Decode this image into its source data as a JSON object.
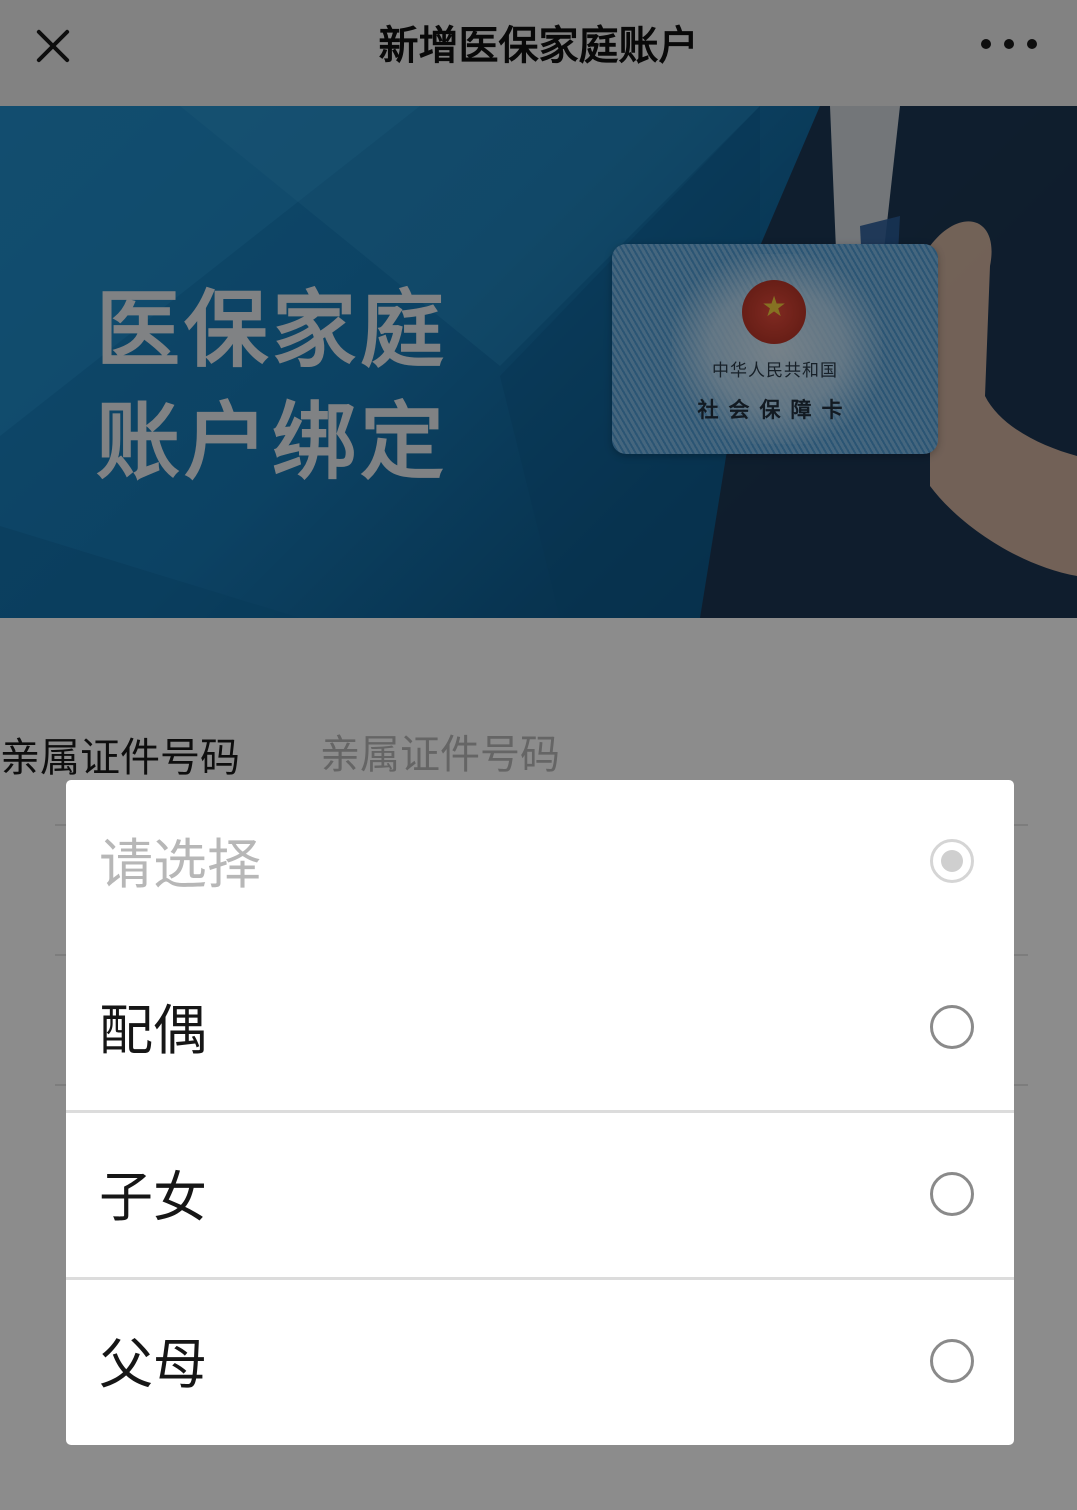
{
  "header": {
    "title": "新增医保家庭账户",
    "close_icon": "close-icon",
    "more_icon": "more-icon"
  },
  "banner": {
    "headline_line1": "医保家庭",
    "headline_line2": "账户绑定",
    "card_line1": "中华人民共和国",
    "card_line2": "社会保障卡"
  },
  "form": {
    "id_label": "亲属证件号码",
    "id_placeholder": "亲属证件号码"
  },
  "dialog": {
    "options": [
      {
        "label": "请选择",
        "selected": true,
        "disabled": true
      },
      {
        "label": "配偶",
        "selected": false
      },
      {
        "label": "子女",
        "selected": false
      },
      {
        "label": "父母",
        "selected": false
      }
    ]
  },
  "colors": {
    "banner_blue": "#1779b5",
    "mask": "rgba(0,0,0,0.45)",
    "placeholder_text": "#b7b7b7"
  }
}
